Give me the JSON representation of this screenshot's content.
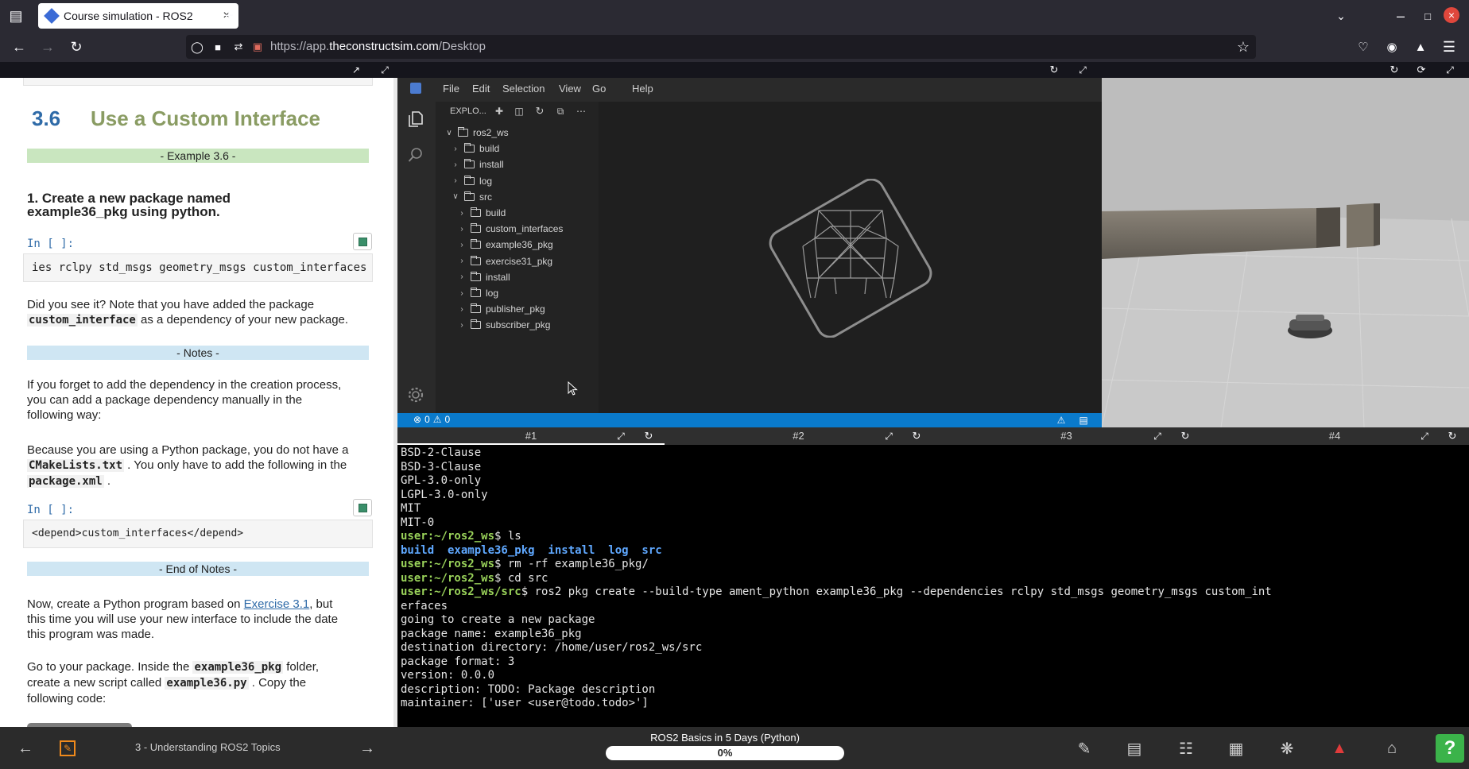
{
  "browser": {
    "tab_title": "Course simulation - ROS2",
    "new_tab": "+",
    "url_prefix": "https://app.",
    "url_domain": "theconstructsim.com",
    "url_path": "/Desktop"
  },
  "notebook": {
    "section_number": "3.6",
    "section_title": "Use a Custom Interface",
    "example_bar": "- Example 3.6 -",
    "step_heading_1": "1. Create a new package named",
    "step_heading_2": "example36_pkg using python.",
    "in_label": "In [ ]:",
    "cell1": "ies rclpy std_msgs geometry_msgs custom_interfaces",
    "p1_a": "Did you see it? Note that you have added the package",
    "p1_code": "custom_interface",
    "p1_b": " as a dependency of your new package.",
    "notes_bar": "- Notes -",
    "p2_1": "If you forget to add the dependency in the creation process,",
    "p2_2": "you can add a package dependency manually in the",
    "p2_3": "following way:",
    "p3_1": "Because you are using a Python package, you do not have a",
    "p3_code1": "CMakeLists.txt",
    "p3_b": " . You only have to add the following in the",
    "p3_code2": "package.xml",
    "p3_c": " .",
    "cell2": "<depend>custom_interfaces</depend>",
    "end_notes_bar": "- End of Notes -",
    "p4_a": "Now, create a Python program based on ",
    "p4_link": "Exercise 3.1",
    "p4_b": ", but",
    "p4_2": "this time you will use your new interface to include the date",
    "p4_3": "this program was made.",
    "p5_a": "Go to your package. Inside the ",
    "p5_code1": "example36_pkg",
    "p5_b": " folder,",
    "p5_c": "create a new script called ",
    "p5_code2": "example36.py",
    "p5_d": " . Copy the",
    "p5_3": "following code:"
  },
  "vscode": {
    "menu": [
      "File",
      "Edit",
      "Selection",
      "View",
      "Go",
      "Help"
    ],
    "explorer_label": "EXPLO...",
    "tree": [
      {
        "label": "ros2_ws",
        "level": 0,
        "open": true
      },
      {
        "label": "build",
        "level": 1,
        "open": false
      },
      {
        "label": "install",
        "level": 1,
        "open": false
      },
      {
        "label": "log",
        "level": 1,
        "open": false
      },
      {
        "label": "src",
        "level": 1,
        "open": true
      },
      {
        "label": "build",
        "level": 2,
        "open": false
      },
      {
        "label": "custom_interfaces",
        "level": 2,
        "open": false
      },
      {
        "label": "example36_pkg",
        "level": 2,
        "open": false
      },
      {
        "label": "exercise31_pkg",
        "level": 2,
        "open": false
      },
      {
        "label": "install",
        "level": 2,
        "open": false
      },
      {
        "label": "log",
        "level": 2,
        "open": false
      },
      {
        "label": "publisher_pkg",
        "level": 2,
        "open": false
      },
      {
        "label": "subscriber_pkg",
        "level": 2,
        "open": false
      }
    ],
    "status_errors": "0",
    "status_warnings": "0"
  },
  "terminal": {
    "tabs": [
      "#1",
      "#2",
      "#3",
      "#4"
    ],
    "lines": [
      {
        "t": "BSD-2-Clause"
      },
      {
        "t": "BSD-3-Clause"
      },
      {
        "t": "GPL-3.0-only"
      },
      {
        "t": "LGPL-3.0-only"
      },
      {
        "t": "MIT"
      },
      {
        "t": "MIT-0"
      },
      {
        "p": "user:~/ros2_ws",
        "t": "$ ls"
      },
      {
        "b": "build  example36_pkg  install  log  src"
      },
      {
        "p": "user:~/ros2_ws",
        "t": "$ rm -rf example36_pkg/"
      },
      {
        "p": "user:~/ros2_ws",
        "t": "$ cd src"
      },
      {
        "p": "user:~/ros2_ws/src",
        "t": "$ ros2 pkg create --build-type ament_python example36_pkg --dependencies rclpy std_msgs geometry_msgs custom_int"
      },
      {
        "t": "erfaces"
      },
      {
        "t": "going to create a new package"
      },
      {
        "t": "package name: example36_pkg"
      },
      {
        "t": "destination directory: /home/user/ros2_ws/src"
      },
      {
        "t": "package format: 3"
      },
      {
        "t": "version: 0.0.0"
      },
      {
        "t": "description: TODO: Package description"
      },
      {
        "t": "maintainer: ['user <user@todo.todo>']"
      }
    ]
  },
  "bottom": {
    "unit_label": "3 - Understanding ROS2 Topics",
    "course_title": "ROS2 Basics in 5 Days (Python)",
    "progress": "0%",
    "help": "?"
  }
}
